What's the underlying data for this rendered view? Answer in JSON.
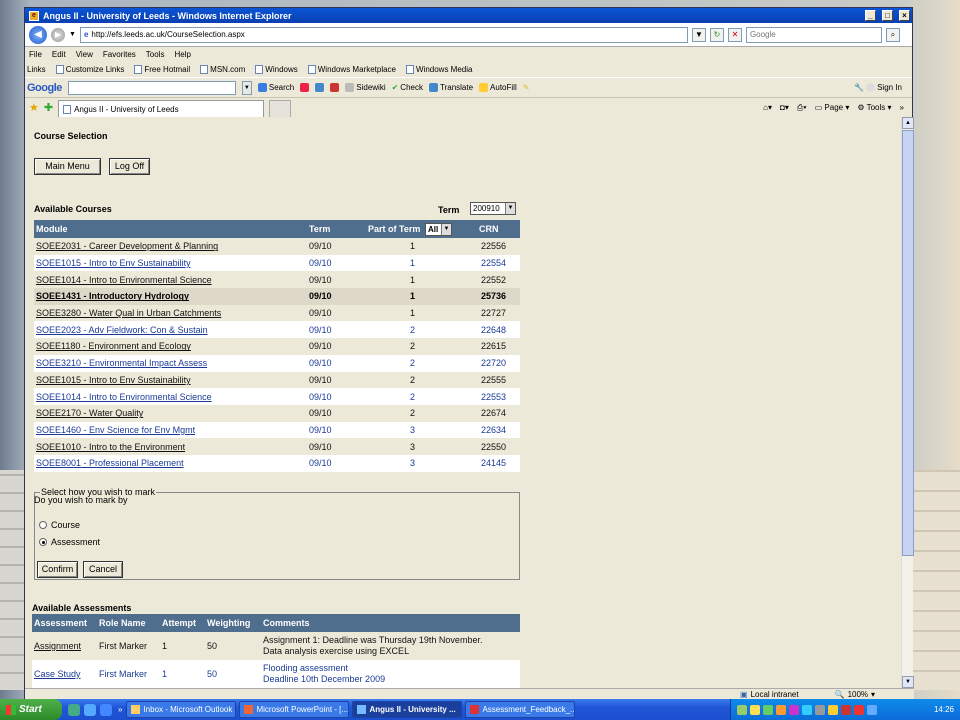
{
  "window": {
    "title": "Angus II - University of Leeds - Windows Internet Explorer",
    "controls": [
      "_",
      "□",
      "×"
    ]
  },
  "address": {
    "url": "http://efs.leeds.ac.uk/CourseSelection.aspx",
    "search_placeholder": "Google"
  },
  "menu": [
    "File",
    "Edit",
    "View",
    "Favorites",
    "Tools",
    "Help"
  ],
  "links": {
    "label": "Links",
    "items": [
      "Customize Links",
      "Free Hotmail",
      "MSN.com",
      "Windows",
      "Windows Marketplace",
      "Windows Media"
    ]
  },
  "googlebar": {
    "logo": "Google",
    "search": "Search",
    "sidewiki": "Sidewiki",
    "check": "Check",
    "translate": "Translate",
    "autofill": "AutoFill",
    "signin": "Sign In"
  },
  "tab": {
    "label": "Angus II - University of Leeds",
    "page": "Page",
    "tools": "Tools"
  },
  "page": {
    "title": "Course Selection",
    "main_menu": "Main Menu",
    "log_off": "Log Off",
    "available_courses": "Available Courses",
    "term_label": "Term",
    "term_value": "200910",
    "part_filter": "All",
    "columns": {
      "module": "Module",
      "term": "Term",
      "part": "Part of Term",
      "crn": "CRN"
    },
    "courses": [
      {
        "module": "SOEE2031 - Career Development & Planning",
        "term": "09/10",
        "part": "1",
        "crn": "22556"
      },
      {
        "module": "SOEE1015 - Intro to Env Sustainability",
        "term": "09/10",
        "part": "1",
        "crn": "22554"
      },
      {
        "module": "SOEE1014 - Intro to Environmental Science",
        "term": "09/10",
        "part": "1",
        "crn": "22552"
      },
      {
        "module": "SOEE1431 - Introductory Hydrology",
        "term": "09/10",
        "part": "1",
        "crn": "25736",
        "selected": true
      },
      {
        "module": "SOEE3280 - Water Qual in Urban Catchments",
        "term": "09/10",
        "part": "1",
        "crn": "22727"
      },
      {
        "module": "SOEE2023 - Adv Fieldwork: Con & Sustain",
        "term": "09/10",
        "part": "2",
        "crn": "22648"
      },
      {
        "module": "SOEE1180 - Environment and Ecology",
        "term": "09/10",
        "part": "2",
        "crn": "22615"
      },
      {
        "module": "SOEE3210 - Environmental Impact Assess",
        "term": "09/10",
        "part": "2",
        "crn": "22720"
      },
      {
        "module": "SOEE1015 - Intro to Env Sustainability",
        "term": "09/10",
        "part": "2",
        "crn": "22555"
      },
      {
        "module": "SOEE1014 - Intro to Environmental Science",
        "term": "09/10",
        "part": "2",
        "crn": "22553"
      },
      {
        "module": "SOEE2170 - Water Quality",
        "term": "09/10",
        "part": "2",
        "crn": "22674"
      },
      {
        "module": "SOEE1460 - Env Science for Env Mgmt",
        "term": "09/10",
        "part": "3",
        "crn": "22634"
      },
      {
        "module": "SOEE1010 - Intro to the Environment",
        "term": "09/10",
        "part": "3",
        "crn": "22550"
      },
      {
        "module": "SOEE8001 - Professional Placement",
        "term": "09/10",
        "part": "3",
        "crn": "24145"
      }
    ],
    "mark": {
      "legend": "Select how you wish to mark",
      "prompt": "Do you wish to mark by",
      "option_course": "Course",
      "option_assessment": "Assessment",
      "selected": "Assessment",
      "confirm": "Confirm",
      "cancel": "Cancel"
    },
    "available_assessments": "Available Assessments",
    "a_columns": {
      "assessment": "Assessment",
      "role": "Role Name",
      "attempt": "Attempt",
      "weighting": "Weighting",
      "comments": "Comments"
    },
    "assessments": [
      {
        "assessment": "Assignment",
        "role": "First Marker",
        "attempt": "1",
        "weighting": "50",
        "comment1": "Assignment 1: Deadline was Thursday 19th November.",
        "comment2": "Data analysis exercise using EXCEL"
      },
      {
        "assessment": "Case Study",
        "role": "First Marker",
        "attempt": "1",
        "weighting": "50",
        "comment1": "Flooding assessment",
        "comment2": "Deadline 10th December 2009"
      }
    ]
  },
  "status": {
    "zone": "Local intranet",
    "zoom": "100%"
  },
  "taskbar": {
    "start": "Start",
    "buttons": [
      "Inbox - Microsoft Outlook",
      "Microsoft PowerPoint - [...",
      "Angus II - University ...",
      "Assessment_Feedback_..."
    ],
    "active_index": 2,
    "clock": "14:26"
  }
}
